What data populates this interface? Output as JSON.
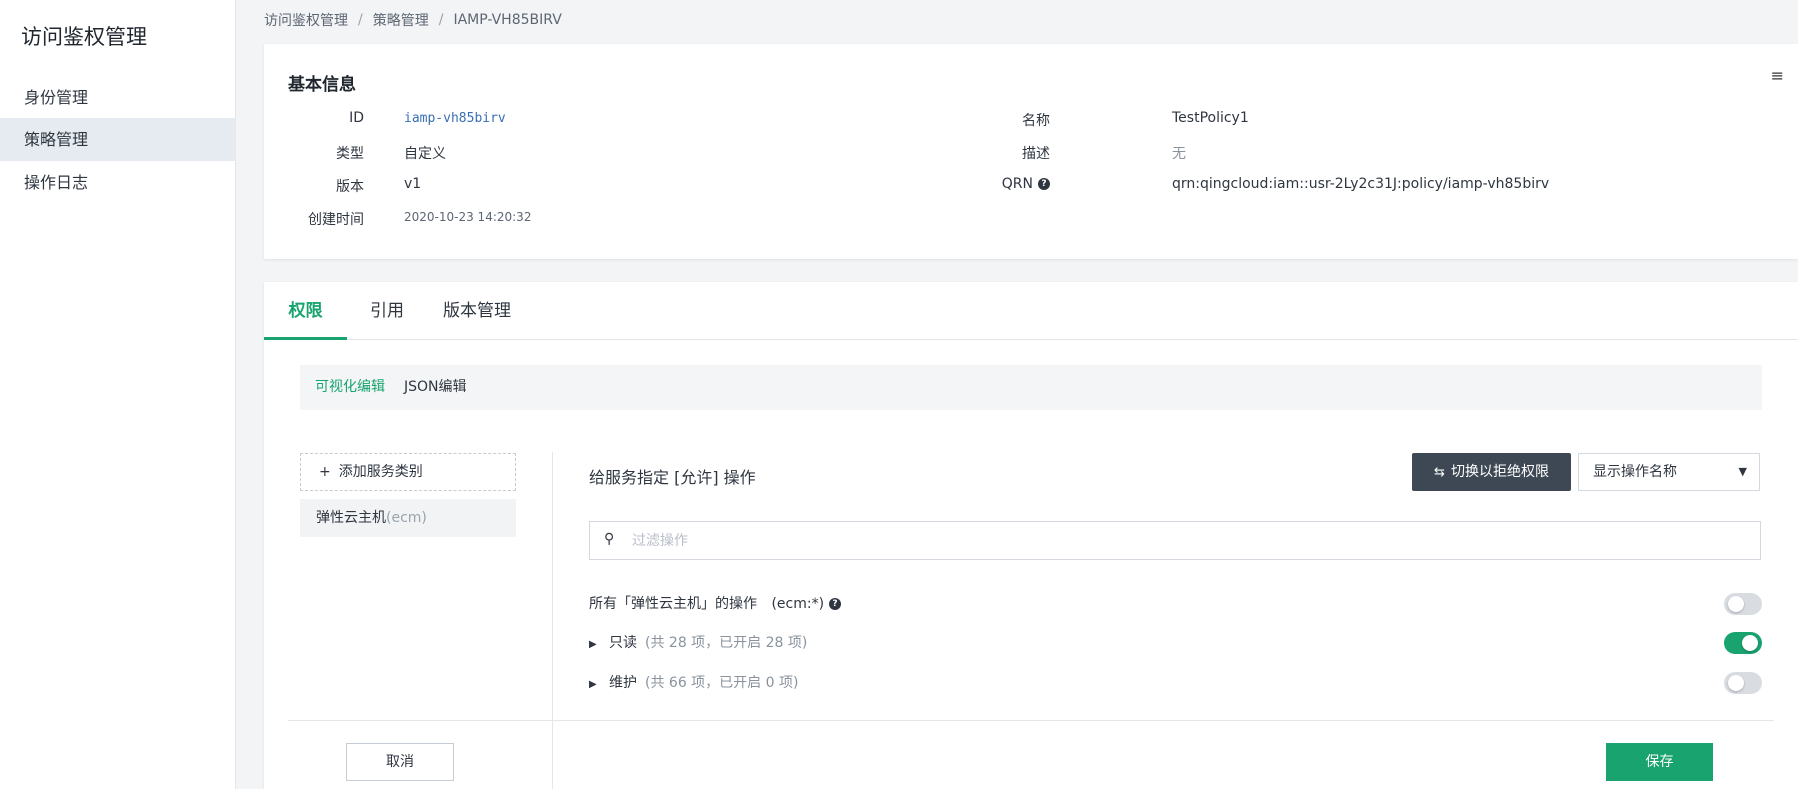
{
  "sidebar": {
    "title": "访问鉴权管理",
    "items": [
      {
        "label": "身份管理",
        "active": false
      },
      {
        "label": "策略管理",
        "active": true
      },
      {
        "label": "操作日志",
        "active": false
      }
    ]
  },
  "breadcrumb": [
    "访问鉴权管理",
    "策略管理",
    "IAMP-VH85BIRV"
  ],
  "breadcrumb_sep": "/",
  "info": {
    "title": "基本信息",
    "left": [
      {
        "label": "ID",
        "value": "iamp-vh85birv"
      },
      {
        "label": "类型",
        "value": "自定义"
      },
      {
        "label": "版本",
        "value": "v1"
      },
      {
        "label": "创建时间",
        "value": "2020-10-23 14:20:32"
      }
    ],
    "right": [
      {
        "label": "名称",
        "value": "TestPolicy1"
      },
      {
        "label": "描述",
        "value": "无"
      },
      {
        "label": "QRN",
        "value": "qrn:qingcloud:iam::usr-2Ly2c31J:policy/iamp-vh85birv"
      }
    ]
  },
  "tabs": [
    {
      "label": "权限",
      "active": true
    },
    {
      "label": "引用",
      "active": false
    },
    {
      "label": "版本管理",
      "active": false
    }
  ],
  "modes": [
    {
      "label": "可视化编辑",
      "active": true
    },
    {
      "label": "JSON编辑",
      "active": false
    }
  ],
  "services": {
    "add_label": "添加服务类别",
    "items": [
      {
        "name": "弹性云主机",
        "code": "(ecm)"
      }
    ]
  },
  "policy": {
    "title": "给服务指定 [允许] 操作",
    "switch_button": "切换以拒绝权限",
    "display_select": "显示操作名称",
    "search_placeholder": "过滤操作",
    "all_ops_label": "所有「弹性云主机」的操作",
    "all_ops_code": "(ecm:*)",
    "all_ops_enabled": false,
    "groups": [
      {
        "name": "只读",
        "meta": "(共 28 项，已开启 28 项)",
        "enabled": true
      },
      {
        "name": "维护",
        "meta": "(共 66 项，已开启 0 项)",
        "enabled": false
      }
    ]
  },
  "footer": {
    "cancel": "取消",
    "save": "保存"
  },
  "colors": {
    "accent": "#19a36f",
    "dark_button": "#3d4854",
    "link": "#3a6fb5"
  }
}
